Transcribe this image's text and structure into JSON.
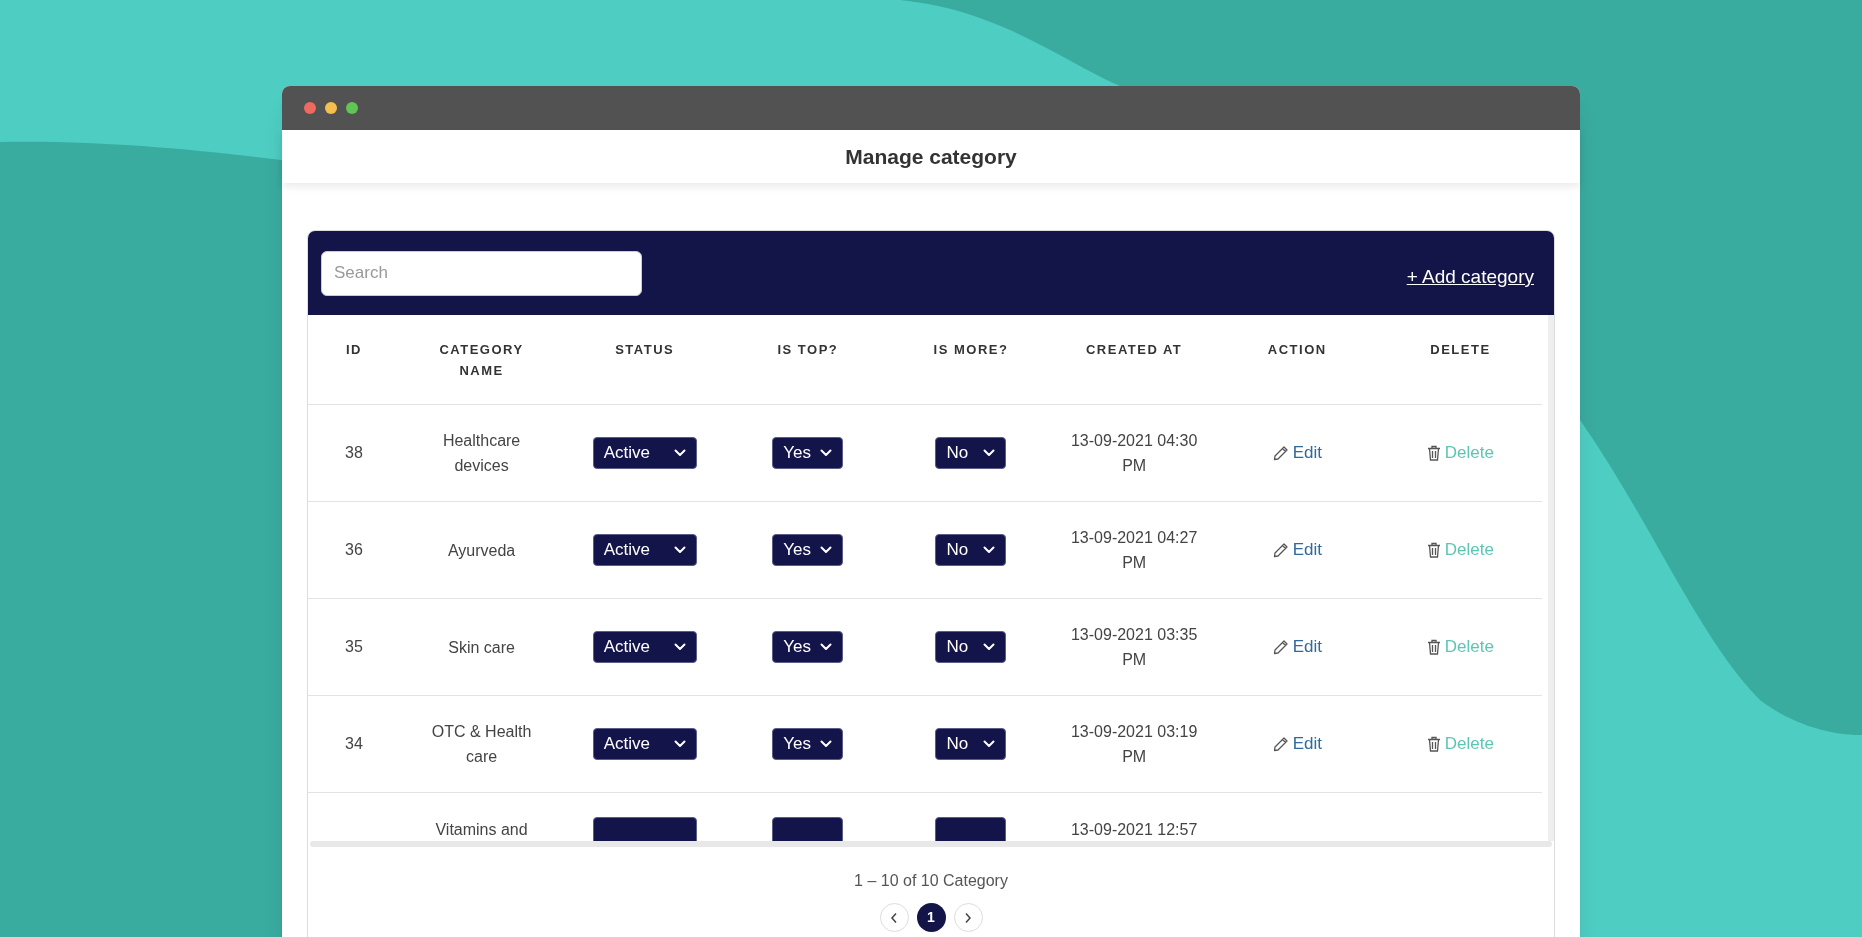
{
  "window": {
    "title": "Manage category"
  },
  "toolbar": {
    "search": {
      "placeholder": "Search"
    },
    "add_link": "+ Add category"
  },
  "table": {
    "columns": [
      "ID",
      "CATEGORY NAME",
      "STATUS",
      "IS TOP?",
      "IS MORE?",
      "CREATED AT",
      "ACTION",
      "DELETE"
    ],
    "rows": [
      {
        "id": "38",
        "name": "Healthcare devices",
        "status": "Active",
        "is_top": "Yes",
        "is_more": "No",
        "created_at": "13-09-2021 04:30 PM",
        "action": "Edit",
        "delete": "Delete"
      },
      {
        "id": "36",
        "name": "Ayurveda",
        "status": "Active",
        "is_top": "Yes",
        "is_more": "No",
        "created_at": "13-09-2021 04:27 PM",
        "action": "Edit",
        "delete": "Delete"
      },
      {
        "id": "35",
        "name": "Skin care",
        "status": "Active",
        "is_top": "Yes",
        "is_more": "No",
        "created_at": "13-09-2021 03:35 PM",
        "action": "Edit",
        "delete": "Delete"
      },
      {
        "id": "34",
        "name": "OTC & Health care",
        "status": "Active",
        "is_top": "Yes",
        "is_more": "No",
        "created_at": "13-09-2021 03:19 PM",
        "action": "Edit",
        "delete": "Delete"
      },
      {
        "name": "Vitamins and",
        "created_at": "13-09-2021 12:57"
      }
    ]
  },
  "pagination": {
    "summary": "1 – 10 of 10 Category",
    "pages": [
      {
        "label": "1",
        "selected": true
      }
    ]
  }
}
